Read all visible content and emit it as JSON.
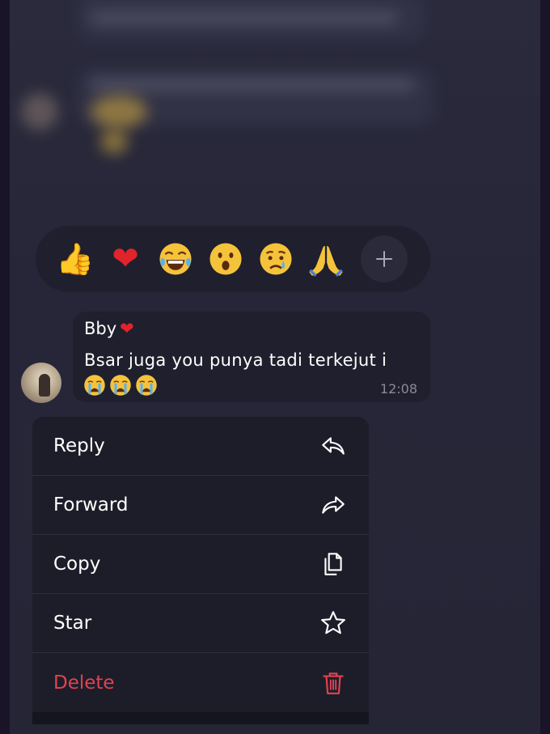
{
  "reactions": [
    {
      "name": "thumbs-up-emoji",
      "glyph": "👍"
    },
    {
      "name": "heart-emoji",
      "glyph": "❤"
    },
    {
      "name": "laughing-emoji",
      "glyph": "😂"
    },
    {
      "name": "surprised-emoji",
      "glyph": "😮"
    },
    {
      "name": "crying-emoji",
      "glyph": "😢"
    },
    {
      "name": "pray-emoji",
      "glyph": "🙏"
    }
  ],
  "message": {
    "sender": "Bby",
    "sender_heart": "❤",
    "text": "Bsar juga you punya tadi terkejut i",
    "trailing_emojis": "😭😭😭",
    "time": "12:08"
  },
  "menu": {
    "items": [
      {
        "label": "Reply",
        "icon": "reply-icon"
      },
      {
        "label": "Forward",
        "icon": "forward-icon"
      },
      {
        "label": "Copy",
        "icon": "copy-icon"
      },
      {
        "label": "Star",
        "icon": "star-icon"
      },
      {
        "label": "Delete",
        "icon": "trash-icon"
      }
    ]
  },
  "colors": {
    "accent_danger": "#e0434f",
    "menu_bg": "#1d1d2a",
    "bubble_bg": "#1f1f2d",
    "text_primary": "#ffffff",
    "text_secondary": "#8a8a9c"
  }
}
